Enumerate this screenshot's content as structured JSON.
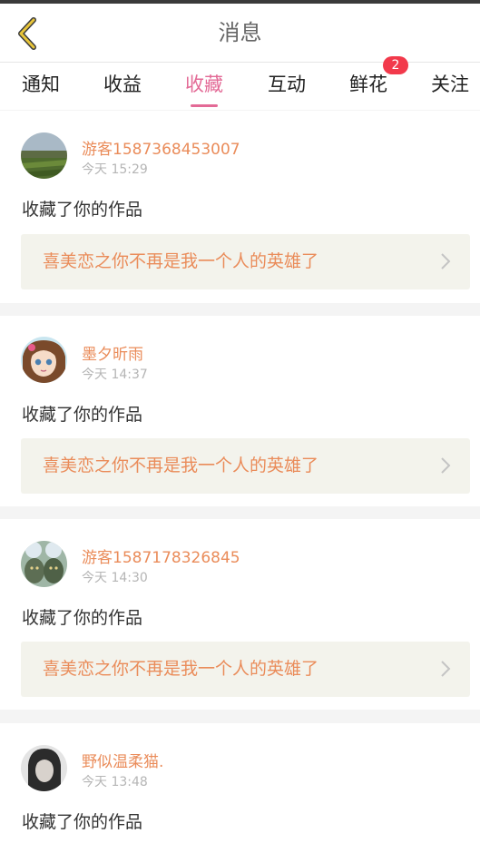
{
  "header": {
    "title": "消息",
    "back_icon": "chevron-left-icon",
    "accent": "#e8c53a"
  },
  "tabs": [
    {
      "label": "通知",
      "active": false
    },
    {
      "label": "收益",
      "active": false
    },
    {
      "label": "收藏",
      "active": true
    },
    {
      "label": "互动",
      "active": false
    },
    {
      "label": "鲜花",
      "active": false,
      "badge": "2"
    },
    {
      "label": "关注",
      "active": false
    }
  ],
  "colors": {
    "active_tab": "#e36a96",
    "username": "#ea8c5a",
    "badge": "#f2394b",
    "card_link_bg": "#f3f3ec"
  },
  "messages": [
    {
      "username": "游客1587368453007",
      "time": "今天 15:29",
      "action": "收藏了你的作品",
      "work_title": "喜美恋之你不再是我一个人的英雄了"
    },
    {
      "username": "墨夕昕雨",
      "time": "今天 14:37",
      "action": "收藏了你的作品",
      "work_title": "喜美恋之你不再是我一个人的英雄了"
    },
    {
      "username": "游客1587178326845",
      "time": "今天 14:30",
      "action": "收藏了你的作品",
      "work_title": "喜美恋之你不再是我一个人的英雄了"
    },
    {
      "username": "野似温柔猫.",
      "time": "今天 13:48",
      "action": "收藏了你的作品",
      "work_title": ""
    }
  ]
}
